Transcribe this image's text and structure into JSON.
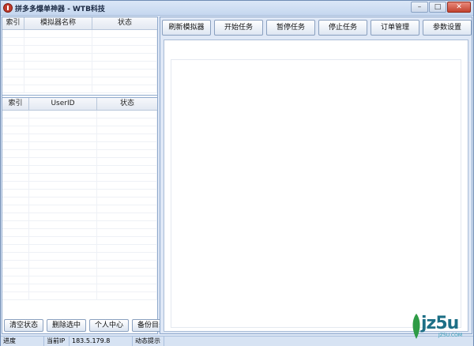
{
  "window": {
    "title": "拼多多爆单神器 - WTB科技",
    "controls": {
      "minimize": "–",
      "maximize": "□",
      "close": "✕"
    }
  },
  "emulator_table": {
    "columns": [
      "索引",
      "模拟器名称",
      "状态"
    ],
    "rows": 8
  },
  "user_table": {
    "columns": [
      "索引",
      "UserID",
      "状态"
    ],
    "rows": 24
  },
  "left_buttons": [
    "清空状态",
    "删除选中",
    "个人中心",
    "备份目录"
  ],
  "toolbar": [
    "刷新模拟器",
    "开始任务",
    "暂停任务",
    "停止任务",
    "订单管理",
    "参数设置"
  ],
  "statusbar": {
    "progress_label": "进度",
    "ip_label": "当前IP",
    "ip_value": "183.5.179.8",
    "hint_label": "动态提示"
  },
  "watermark": {
    "brand": "jz5u",
    "site": "JZ5U.COM"
  },
  "colors": {
    "accent": "#6f8cb4",
    "panel": "#dfe8f6",
    "close": "#c2422f"
  }
}
